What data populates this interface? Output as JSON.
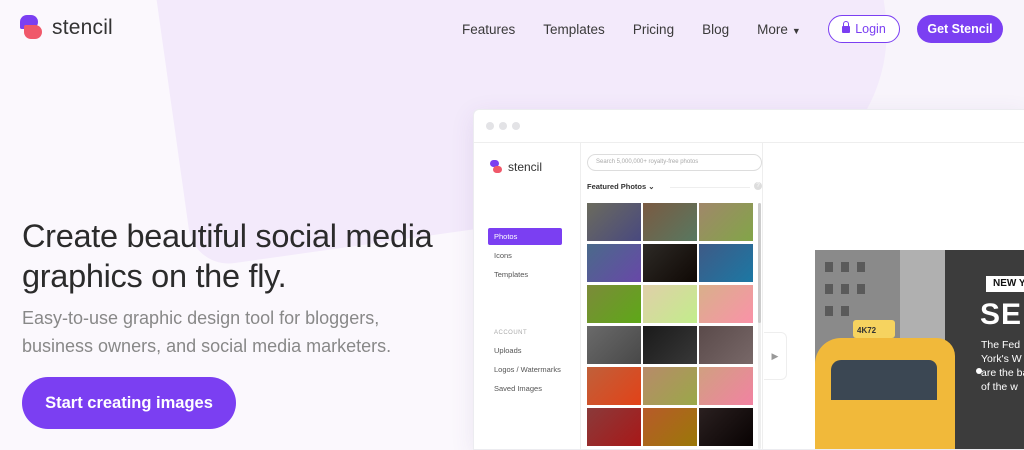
{
  "brand": {
    "name": "stencil"
  },
  "nav": {
    "items": [
      "Features",
      "Templates",
      "Pricing",
      "Blog",
      "More"
    ],
    "login": "Login",
    "get_started": "Get Stencil"
  },
  "hero": {
    "title": "Create beautiful social media graphics on the fly.",
    "subtitle": "Easy-to-use graphic design tool for bloggers, business owners, and social media marketers.",
    "cta": "Start creating images"
  },
  "app": {
    "brand": "stencil",
    "search_placeholder": "Search 5,000,000+ royalty-free photos",
    "featured": "Featured Photos",
    "sidebar": {
      "items": [
        "Photos",
        "Icons",
        "Templates"
      ],
      "section": "ACCOUNT",
      "account_items": [
        "Uploads",
        "Logos / Watermarks",
        "Saved Images"
      ]
    },
    "canvas": {
      "badge": "NEW Y",
      "headline": "SE",
      "body": "The Fed York's W hat are the ban of the w",
      "plate": "4K72"
    }
  },
  "colors": {
    "accent": "#7b3ff2",
    "logo_secondary": "#f0586a"
  },
  "thumbs": [
    "#6b6b5d",
    "#7a5a42",
    "#a0876a",
    "#4a6a8a",
    "#2d2a26",
    "#3e5a86",
    "#7c8a3a",
    "#e0cfa9",
    "#d8b08a",
    "#6a6a6a",
    "#1a1a1a",
    "#5a4a4a",
    "#c0603a",
    "#b88a6a",
    "#d0a080",
    "#8a3a3a",
    "#b85a2a",
    "#2a2020"
  ]
}
